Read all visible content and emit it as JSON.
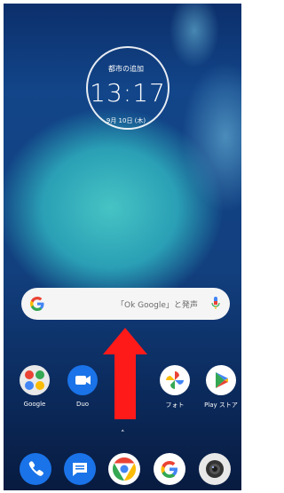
{
  "clock": {
    "city": "都市の追加",
    "time": "13:17",
    "date": "9月 10日 (木)"
  },
  "search": {
    "hint": "「Ok Google」と発声",
    "icon_left": "google-g-icon",
    "icon_right": "microphone-icon"
  },
  "apps": [
    {
      "label": "Google",
      "icon": "google-folder-icon"
    },
    {
      "label": "Duo",
      "icon": "duo-camera-icon"
    },
    {
      "label": "フォト",
      "icon": "photos-pinwheel-icon"
    },
    {
      "label": "Play ストア",
      "icon": "play-store-icon"
    }
  ],
  "dock": [
    {
      "icon": "phone-icon"
    },
    {
      "icon": "messages-icon"
    },
    {
      "icon": "chrome-icon"
    },
    {
      "icon": "google-icon"
    },
    {
      "icon": "camera-icon"
    }
  ],
  "overlay": {
    "arrow_color": "#ff1a1a",
    "direction": "up"
  },
  "app_drawer_hint": "˄"
}
